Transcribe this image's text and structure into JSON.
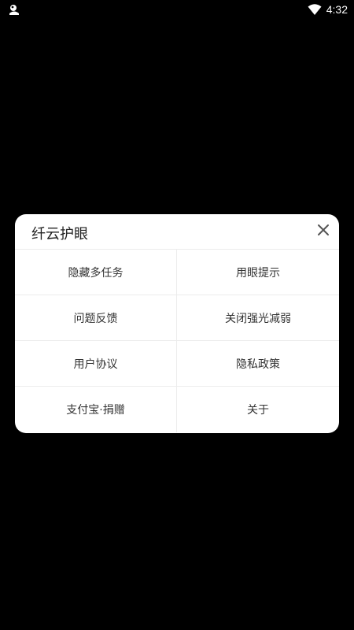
{
  "status_bar": {
    "time": "4:32",
    "app_icon": "notification-app-icon",
    "wifi_icon": "wifi-icon"
  },
  "dialog": {
    "title": "纤云护眼",
    "close_icon": "close-icon",
    "menu": [
      {
        "label": "隐藏多任务"
      },
      {
        "label": "用眼提示"
      },
      {
        "label": "问题反馈"
      },
      {
        "label": "关闭强光减弱"
      },
      {
        "label": "用户协议"
      },
      {
        "label": "隐私政策"
      },
      {
        "label": "支付宝·捐赠"
      },
      {
        "label": "关于"
      }
    ]
  },
  "colors": {
    "background": "#000000",
    "dialog_background": "#ffffff",
    "divider": "#ececec",
    "text": "#333333"
  }
}
